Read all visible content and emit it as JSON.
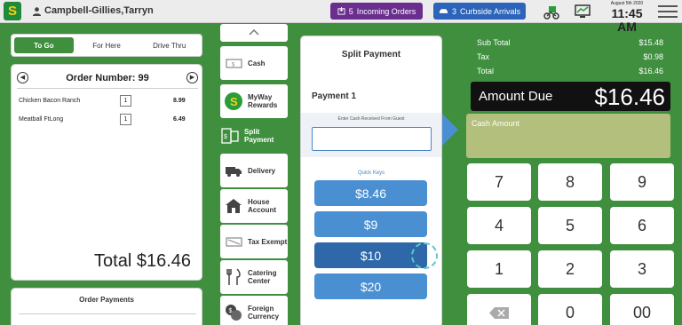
{
  "header": {
    "logo_letter": "S",
    "user_name": "Campbell-Gillies,Tarryn",
    "incoming": {
      "count": "5",
      "label": "Incoming Orders"
    },
    "curbside": {
      "count": "3",
      "label": "Curbside Arrivals"
    },
    "date": "August 5th 2020",
    "time": "11:45 AM",
    "colors": {
      "incoming": "#6a2e8f",
      "curbside": "#2c64b9",
      "brand": "#3f8f3f"
    }
  },
  "order": {
    "tabs": [
      {
        "label": "To Go",
        "active": true
      },
      {
        "label": "For Here",
        "active": false
      },
      {
        "label": "Drive Thru",
        "active": false
      }
    ],
    "number_label": "Order Number: 99",
    "items": [
      {
        "name": "Chicken Bacon Ranch",
        "qty": "1",
        "price": "8.99"
      },
      {
        "name": "Meatball FtLong",
        "qty": "1",
        "price": "6.49"
      }
    ],
    "total": "Total $16.46",
    "payments_title": "Order Payments"
  },
  "payment_methods": [
    {
      "label": "Cash",
      "icon": "cash-icon",
      "active": false
    },
    {
      "label": "MyWay Rewards",
      "icon": "subway-rewards-icon",
      "active": false
    },
    {
      "label": "Split Payment",
      "icon": "split-payment-icon",
      "active": true
    },
    {
      "label": "Delivery",
      "icon": "delivery-truck-icon",
      "active": false
    },
    {
      "label": "House Account",
      "icon": "house-icon",
      "active": false
    },
    {
      "label": "Tax Exempt",
      "icon": "tax-exempt-icon",
      "active": false
    },
    {
      "label": "Catering Center",
      "icon": "catering-icon",
      "active": false
    },
    {
      "label": "Foreign Currency",
      "icon": "foreign-currency-icon",
      "active": false
    }
  ],
  "split": {
    "title": "Split Payment",
    "payment_label": "Payment 1",
    "cash_prompt": "Enter Cash Received From Guest",
    "cash_value": "",
    "quick_keys_label": "Quick Keys",
    "quick_keys": [
      "$8.46",
      "$9",
      "$10",
      "$20"
    ],
    "active_quick_key": "$10"
  },
  "summary": {
    "subtotal_label": "Sub Total",
    "subtotal": "$15.48",
    "tax_label": "Tax",
    "tax": "$0.98",
    "total_label": "Total",
    "total": "$16.46",
    "amount_due_label": "Amount Due",
    "amount_due": "$16.46",
    "cash_amount_label": "Cash Amount"
  },
  "keypad": [
    "7",
    "8",
    "9",
    "4",
    "5",
    "6",
    "1",
    "2",
    "3",
    "backspace",
    "0",
    "00"
  ]
}
